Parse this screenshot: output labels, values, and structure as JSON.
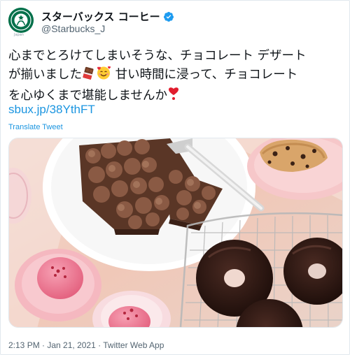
{
  "account": {
    "display_name": "スターバックス コーヒー",
    "handle": "@Starbucks_J",
    "avatar_caption": "Japan",
    "verified": true
  },
  "tweet": {
    "line1": "心までとろけてしまいそうな、チョコレート デザート",
    "line2_a": "が揃いました",
    "line2_b": " 甘い時間に浸って、チョコレート",
    "line3": "を心ゆくまで堪能しませんか",
    "link": "sbux.jp/38YthFT",
    "translate_label": "Translate Tweet",
    "emojis": [
      "chocolate-bar-icon",
      "smiling-face-with-hearts-icon",
      "red-heart-exclamation-icon"
    ]
  },
  "photo": {
    "subject": "chocolate desserts"
  },
  "meta": {
    "time": "2:13 PM",
    "date": "Jan 21, 2021",
    "source": "Twitter Web App",
    "separator": " · "
  },
  "colors": {
    "link": "#1b95e0",
    "verified": "#1d9bf0",
    "brand": "#00704a"
  }
}
